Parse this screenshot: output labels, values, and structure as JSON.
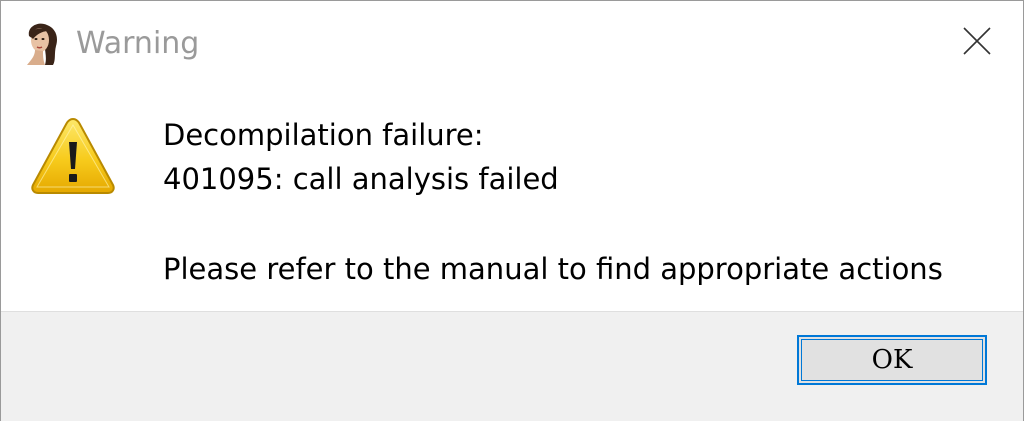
{
  "window": {
    "title": "Warning",
    "title_color": "#9a9a9a"
  },
  "icons": {
    "app": "portrait-icon",
    "message": "warning-icon",
    "close": "close-icon"
  },
  "message": {
    "line1": "Decompilation failure:",
    "line2": "401095: call analysis failed",
    "line3": "Please refer to the manual to find appropriate actions"
  },
  "buttons": {
    "ok_label": "OK"
  },
  "colors": {
    "accent": "#0078d7",
    "footer_bg": "#f0f0f0",
    "warning_yellow": "#f5c400"
  }
}
